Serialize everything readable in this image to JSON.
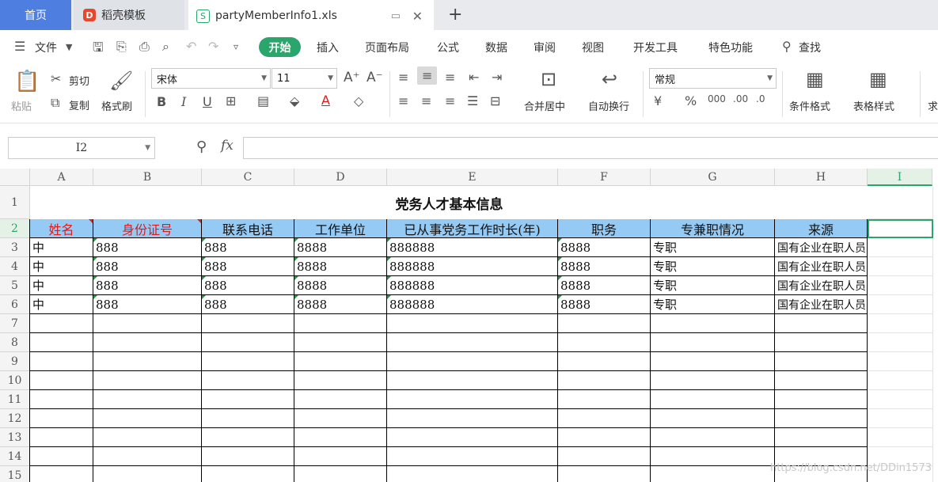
{
  "tabs": {
    "home": "首页",
    "template": "稻壳模板",
    "file": "partyMemberInfo1.xls",
    "template_logo": "D",
    "file_logo": "S"
  },
  "menu": {
    "file": "文件",
    "items": [
      "开始",
      "插入",
      "页面布局",
      "公式",
      "数据",
      "审阅",
      "视图",
      "开发工具",
      "特色功能",
      "查找"
    ]
  },
  "ribbon": {
    "paste": "粘贴",
    "cut": "剪切",
    "copy": "复制",
    "format_painter": "格式刷",
    "font_name": "宋体",
    "font_size": "11",
    "merge_center": "合并居中",
    "wrap_text": "自动换行",
    "number_format": "常规",
    "conditional_format": "条件格式",
    "table_style": "表格样式",
    "more": "求"
  },
  "formula_bar": {
    "name_box": "I2",
    "fx": "fx",
    "value": ""
  },
  "sheet": {
    "columns": [
      "A",
      "B",
      "C",
      "D",
      "E",
      "F",
      "G",
      "H",
      "I"
    ],
    "rows": [
      "1",
      "2",
      "3",
      "4",
      "5",
      "6",
      "7",
      "8",
      "9",
      "10",
      "11",
      "12",
      "13",
      "14",
      "15"
    ],
    "title": "党务人才基本信息",
    "headers": [
      "姓名",
      "身份证号",
      "联系电话",
      "工作单位",
      "已从事党务工作时长(年)",
      "职务",
      "专兼职情况",
      "来源"
    ],
    "data": [
      [
        "中",
        "888",
        "888",
        "8888",
        "888888",
        "8888",
        "专职",
        "国有企业在职人员"
      ],
      [
        "中",
        "888",
        "888",
        "8888",
        "888888",
        "8888",
        "专职",
        "国有企业在职人员"
      ],
      [
        "中",
        "888",
        "888",
        "8888",
        "888888",
        "8888",
        "专职",
        "国有企业在职人员"
      ],
      [
        "中",
        "888",
        "888",
        "8888",
        "888888",
        "8888",
        "专职",
        "国有企业在职人员"
      ]
    ],
    "selected_cell": "I2"
  },
  "watermark": "https://blog.csdn.net/DDin1573",
  "colors": {
    "accent": "#2aa56b",
    "header_fill": "#95caf5",
    "header_red": "#e01919",
    "home_tab": "#4d7ee0"
  }
}
